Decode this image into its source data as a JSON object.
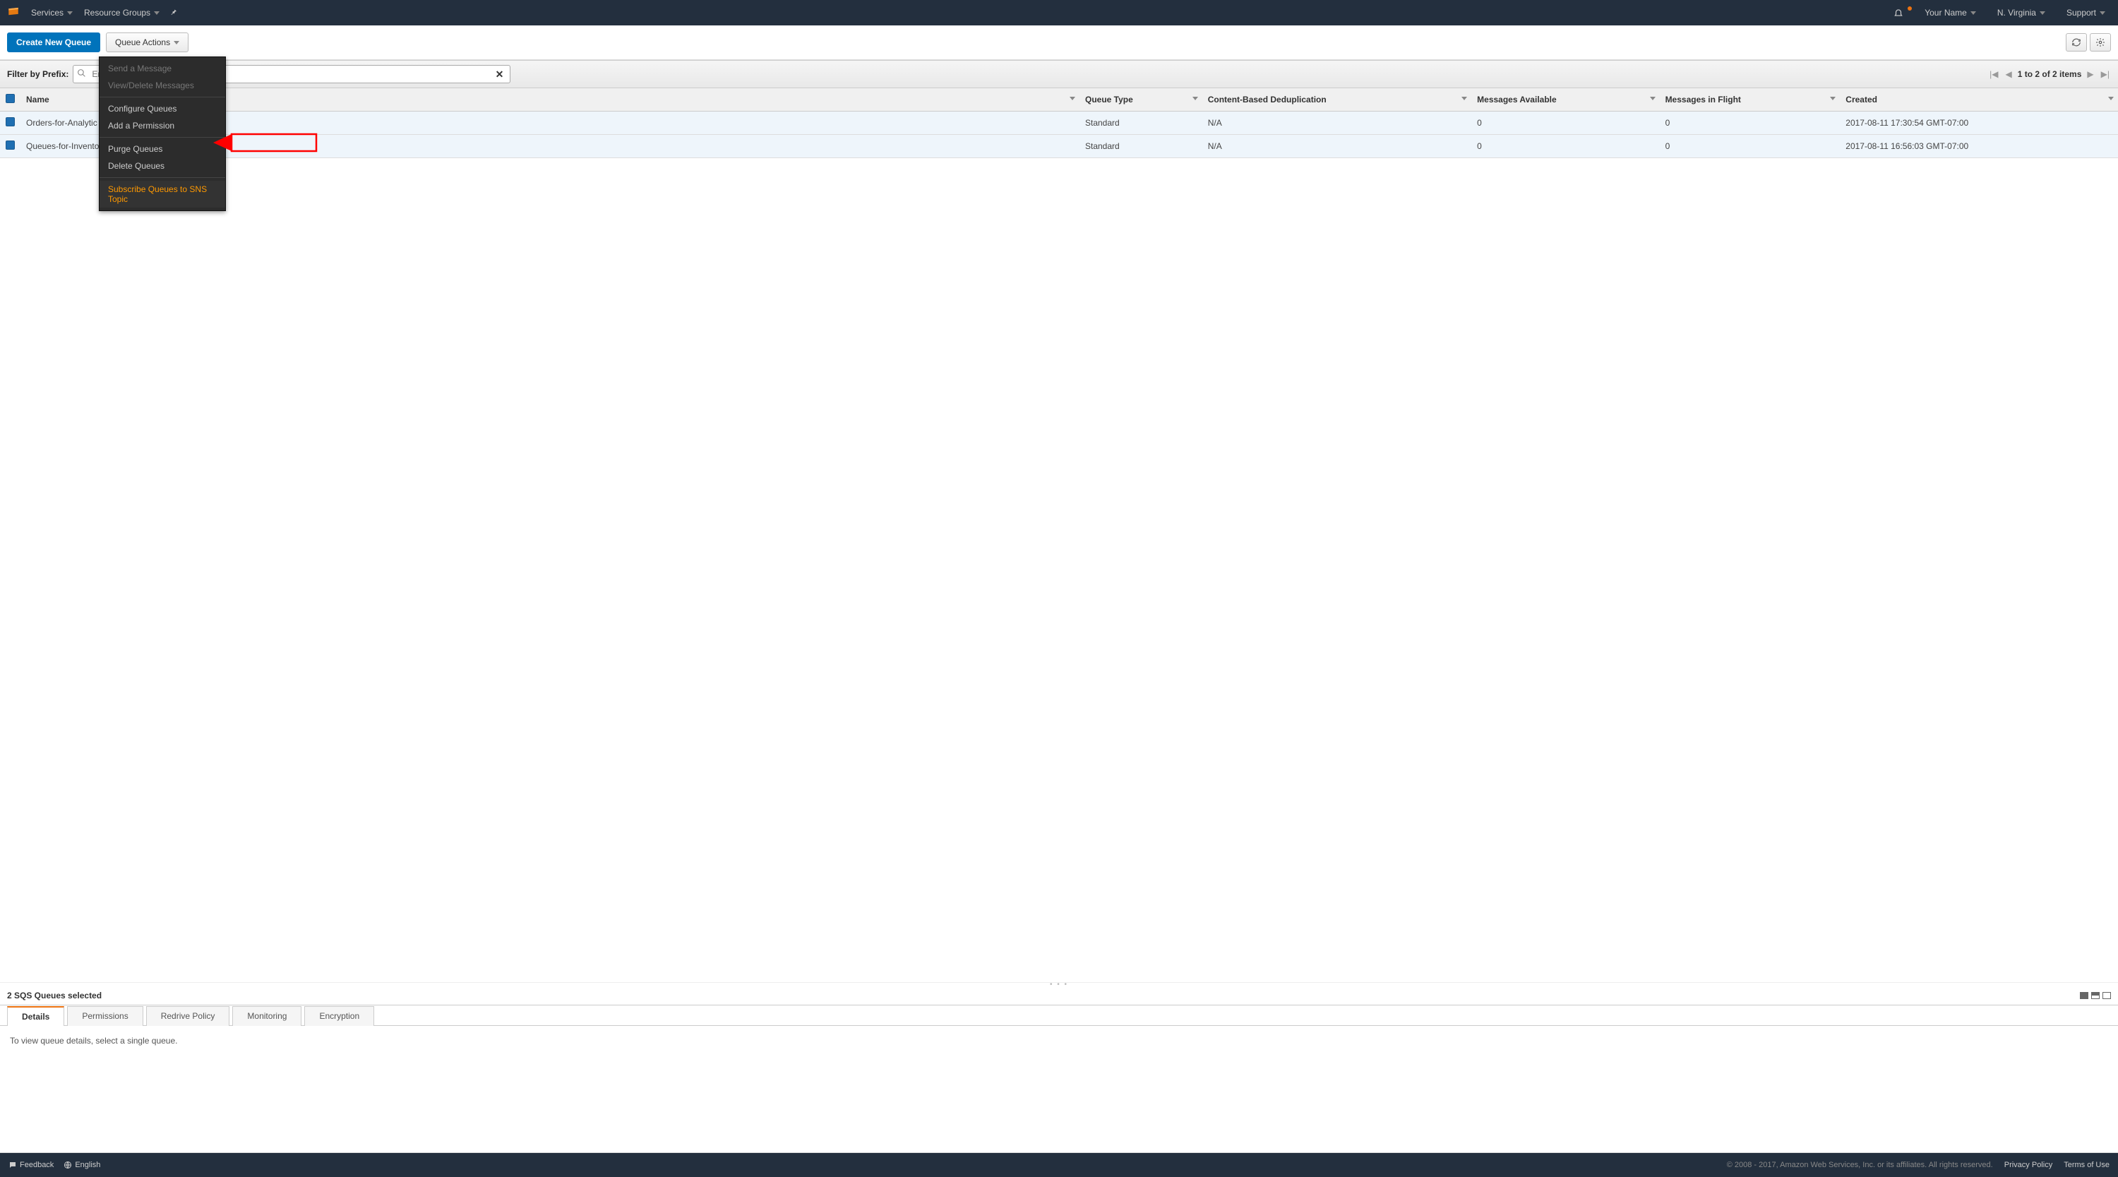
{
  "topnav": {
    "services": "Services",
    "resource_groups": "Resource Groups",
    "your_name": "Your Name",
    "region": "N. Virginia",
    "support": "Support"
  },
  "toolbar": {
    "create": "Create New Queue",
    "actions": "Queue Actions"
  },
  "filter": {
    "label": "Filter by Prefix:",
    "placeholder": "Ente",
    "pager": "1 to 2 of 2 items"
  },
  "columns": {
    "name": "Name",
    "queue_type": "Queue Type",
    "dedup": "Content-Based Deduplication",
    "msgs_avail": "Messages Available",
    "msgs_flight": "Messages in Flight",
    "created": "Created"
  },
  "rows": [
    {
      "name": "Orders-for-Analytic",
      "queue_type": "Standard",
      "dedup": "N/A",
      "msgs_avail": "0",
      "msgs_flight": "0",
      "created": "2017-08-11 17:30:54 GMT-07:00"
    },
    {
      "name": "Queues-for-Invento",
      "queue_type": "Standard",
      "dedup": "N/A",
      "msgs_avail": "0",
      "msgs_flight": "0",
      "created": "2017-08-11 16:56:03 GMT-07:00"
    }
  ],
  "menu": {
    "send": "Send a Message",
    "view_delete": "View/Delete Messages",
    "configure": "Configure Queues",
    "add_perm": "Add a Permission",
    "purge": "Purge Queues",
    "delete": "Delete Queues",
    "subscribe": "Subscribe Queues to SNS Topic"
  },
  "bottom": {
    "title": "2 SQS Queues selected",
    "tabs": {
      "details": "Details",
      "permissions": "Permissions",
      "redrive": "Redrive Policy",
      "monitoring": "Monitoring",
      "encryption": "Encryption"
    },
    "details_text": "To view queue details, select a single queue."
  },
  "footer": {
    "feedback": "Feedback",
    "language": "English",
    "copyright": "© 2008 - 2017, Amazon Web Services, Inc. or its affiliates. All rights reserved.",
    "privacy": "Privacy Policy",
    "terms": "Terms of Use"
  }
}
